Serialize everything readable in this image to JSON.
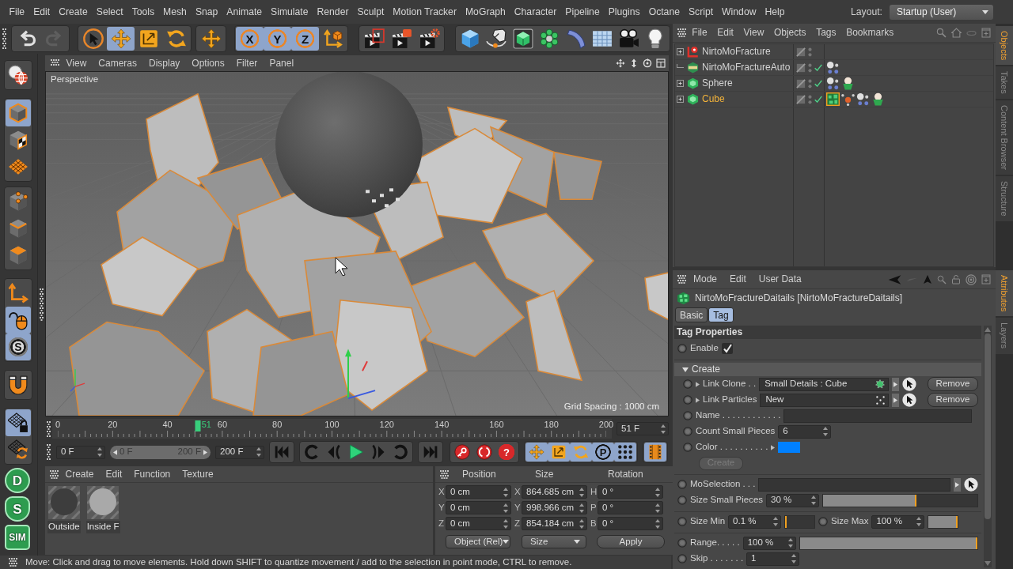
{
  "menubar": {
    "items": [
      "File",
      "Edit",
      "Create",
      "Select",
      "Tools",
      "Mesh",
      "Snap",
      "Animate",
      "Simulate",
      "Render",
      "Sculpt",
      "Motion Tracker",
      "MoGraph",
      "Character",
      "Pipeline",
      "Plugins",
      "Octane",
      "Script",
      "Window",
      "Help"
    ],
    "layout_label": "Layout:",
    "layout_value": "Startup (User)"
  },
  "toolbar": [
    [
      {
        "disabled": false
      },
      {
        "disabled": true
      }
    ],
    [
      {
        "selected": false
      },
      {
        "selected": true
      },
      {
        "selected": false
      },
      {
        "selected": false
      }
    ],
    [
      {
        "selected": false
      }
    ],
    [
      {
        "label": "X",
        "selected": true
      },
      {
        "label": "Y",
        "selected": true
      },
      {
        "label": "Z",
        "selected": true
      },
      {
        "selected": false
      }
    ],
    [
      {
        "selected": false
      },
      {
        "selected": false
      },
      {
        "selected": false
      }
    ],
    [
      {
        "selected": false
      },
      {
        "selected": false
      },
      {
        "selected": false
      },
      {
        "selected": false
      },
      {
        "selected": false
      },
      {
        "selected": false
      },
      {
        "selected": false
      },
      {
        "selected": false
      }
    ]
  ],
  "side_toolbar": {
    "groups": [
      [
        {
          "selected": false
        }
      ],
      [
        {
          "selected": true
        },
        {
          "selected": false
        },
        {
          "selected": false
        }
      ],
      [
        {
          "selected": false
        },
        {
          "selected": false
        },
        {
          "selected": false
        }
      ],
      [
        {
          "selected": false
        },
        {
          "selected": true
        },
        {
          "label": "S",
          "selected": true
        }
      ],
      [
        {
          "selected": false
        }
      ],
      [
        {
          "selected": true
        },
        {
          "selected": false
        }
      ]
    ],
    "plugins": [
      {
        "label": "D"
      },
      {
        "label": "S"
      },
      {
        "label": "SIM"
      }
    ]
  },
  "viewport": {
    "menu": [
      "View",
      "Cameras",
      "Display",
      "Options",
      "Filter",
      "Panel"
    ],
    "camera": "Perspective",
    "grid_spacing": "Grid Spacing : 1000 cm"
  },
  "timeline": {
    "ticks": [
      "0",
      "20",
      "40",
      "60",
      "80",
      "100",
      "120",
      "140",
      "160",
      "180",
      "200"
    ],
    "playhead": {
      "label": "51",
      "level": 0.255
    },
    "frame_field": "51 F"
  },
  "transport": {
    "start_field": "0 F",
    "range": {
      "start": "0 F",
      "end": "200 F"
    },
    "end_field": "200 F",
    "key_selection_mark": "?",
    "track_toggles": [
      {
        "selected": true
      },
      {
        "selected": true
      },
      {
        "selected": true
      },
      {
        "label": "P",
        "selected": true
      },
      {
        "selected": true
      }
    ],
    "timeline_toggle": {
      "selected": true
    }
  },
  "materials": {
    "menu": [
      "Create",
      "Edit",
      "Function",
      "Texture"
    ],
    "items": [
      {
        "name": "Outside",
        "color": "#3d3d3d"
      },
      {
        "name": "Inside F",
        "color": "#a9a9a9"
      }
    ]
  },
  "coordinates": {
    "headers": [
      "Position",
      "Size",
      "Rotation"
    ],
    "rows": [
      [
        {
          "axis": "X",
          "value": "0 cm"
        },
        {
          "axis": "X",
          "value": "864.685 cm"
        },
        {
          "axis": "H",
          "value": "0 °"
        }
      ],
      [
        {
          "axis": "Y",
          "value": "0 cm"
        },
        {
          "axis": "Y",
          "value": "998.966 cm"
        },
        {
          "axis": "P",
          "value": "0 °"
        }
      ],
      [
        {
          "axis": "Z",
          "value": "0 cm"
        },
        {
          "axis": "Z",
          "value": "854.184 cm"
        },
        {
          "axis": "B",
          "value": "0 °"
        }
      ]
    ],
    "mode": "Object (Rel)",
    "size_mode": "Size",
    "apply": "Apply"
  },
  "status_bar": "Move: Click and drag to move elements. Hold down SHIFT to quantize movement / add to the selection in point mode, CTRL to remove.",
  "object_manager": {
    "menu": [
      "File",
      "Edit",
      "View",
      "Objects",
      "Tags",
      "Bookmarks"
    ],
    "objects": [
      {
        "name": "NirtoMoFracture",
        "kind": "generator",
        "collapsed": true,
        "enabled": false,
        "selected": false
      },
      {
        "name": "NirtoMoFractureAuto",
        "kind": "auto",
        "collapsed": false,
        "enabled": true,
        "selected": false,
        "tags": [
          {
            "kind": "dots",
            "selected": false
          }
        ]
      },
      {
        "name": "Sphere",
        "kind": "polygon",
        "collapsed": true,
        "enabled": true,
        "selected": false,
        "tags": [
          {
            "kind": "dots",
            "selected": false
          },
          {
            "kind": "ball",
            "selected": false
          }
        ]
      },
      {
        "name": "Cube",
        "kind": "polygon",
        "collapsed": true,
        "enabled": true,
        "selected": true,
        "tags": [
          {
            "kind": "square",
            "selected": true
          },
          {
            "kind": "spark",
            "selected": false
          },
          {
            "kind": "dots",
            "selected": false
          },
          {
            "kind": "ball",
            "selected": false
          }
        ]
      }
    ]
  },
  "attributes": {
    "menu": [
      "Mode",
      "Edit",
      "User Data"
    ],
    "title": "NirtoMoFractureDaitails [NirtoMoFractureDaitails]",
    "tabs": [
      {
        "label": "Basic",
        "selected": false
      },
      {
        "label": "Tag",
        "selected": true
      }
    ],
    "section": "Tag Properties",
    "enable": {
      "label": "Enable",
      "checked": true
    },
    "group": {
      "label": "Create",
      "expanded": true,
      "rows": [
        {
          "kind": "link",
          "label": "Link Clone . .",
          "value": "Small Details : Cube",
          "action": "Remove"
        },
        {
          "kind": "link",
          "label": "Link Particles",
          "value": "New",
          "action": "Remove"
        },
        {
          "kind": "text",
          "label": "Name . . . . . . . . . . . ."
        },
        {
          "kind": "number",
          "label": "Count Small Pieces",
          "value": "6"
        },
        {
          "kind": "color",
          "label": "Color . . . . . . . . . .",
          "color": "#0080ff"
        },
        {
          "kind": "button",
          "label": "Create",
          "disabled": true
        }
      ]
    },
    "blocks": [
      {
        "kind": "stack",
        "rows": [
          {
            "kind": "link",
            "label": "MoSelection . . ."
          },
          {
            "kind": "slider",
            "label": "Size Small Pieces",
            "value": "30 %",
            "level": 0.6
          }
        ]
      },
      {
        "kind": "inline",
        "rows": [
          {
            "kind": "slider",
            "label": "Size Min",
            "value": "0.1 %",
            "level": 0
          },
          {
            "kind": "slider",
            "label": "Size Max",
            "value": "100 %",
            "level": 1
          }
        ]
      },
      {
        "kind": "stack",
        "rows": [
          {
            "kind": "slider",
            "label": "Range. . . . .",
            "value": "100 %",
            "level": 1
          },
          {
            "kind": "number",
            "label": "Skip . . . . . . .",
            "value": "1"
          }
        ]
      }
    ]
  },
  "side_tabs": {
    "top": [
      {
        "label": "Objects",
        "selected": true
      },
      {
        "label": "Takes",
        "selected": false
      },
      {
        "label": "Content Browser",
        "selected": false
      },
      {
        "label": "Structure",
        "selected": false
      }
    ],
    "bottom": [
      {
        "label": "Attributes",
        "selected": true
      },
      {
        "label": "Layers",
        "selected": false
      }
    ]
  }
}
